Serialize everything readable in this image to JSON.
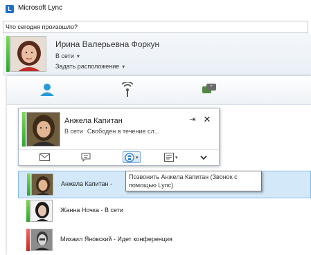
{
  "window": {
    "title": "Microsoft Lync",
    "logo_letter": "L"
  },
  "status_input": {
    "value": "Что сегодня произошло?"
  },
  "me": {
    "name": "Ирина Валерьевна Форкун",
    "status": "В сети",
    "location": "Задать расположение",
    "presence_color": "#3db83d"
  },
  "tabs": [
    {
      "name": "contacts",
      "icon": "person-icon"
    },
    {
      "name": "activity-feeds",
      "icon": "antenna-icon"
    },
    {
      "name": "conversations",
      "icon": "chat-bubble-icon"
    }
  ],
  "contact_card": {
    "name": "Анжела Капитан",
    "status": "В сети",
    "note": "Свободен в течение сл...",
    "actions": [
      {
        "name": "send-email",
        "icon": "envelope-icon"
      },
      {
        "name": "send-im",
        "icon": "speech-bubble-icon"
      },
      {
        "name": "call",
        "icon": "phone-icon",
        "dropdown": true
      },
      {
        "name": "more-options",
        "icon": "card-icon",
        "dropdown": true
      },
      {
        "name": "expand",
        "icon": "chevron-down-icon"
      }
    ]
  },
  "tooltip": {
    "text": "Позвонить Анжела Капитан (Звонок с помощью Lync)"
  },
  "contacts": [
    {
      "label": "Анжела Капитан -",
      "presence": "available",
      "color": "#3db83d",
      "selected": true
    },
    {
      "label": "Жанна Ночка - В сети",
      "presence": "available",
      "color": "#3db83d",
      "selected": false
    },
    {
      "label": "Михаил Яновский - Идет конференция",
      "presence": "busy",
      "color": "#d63a2f",
      "selected": false
    }
  ],
  "colors": {
    "accent": "#1e6fc6",
    "selection": "#d3e9f9",
    "tab_active": "#2a9bd8"
  }
}
